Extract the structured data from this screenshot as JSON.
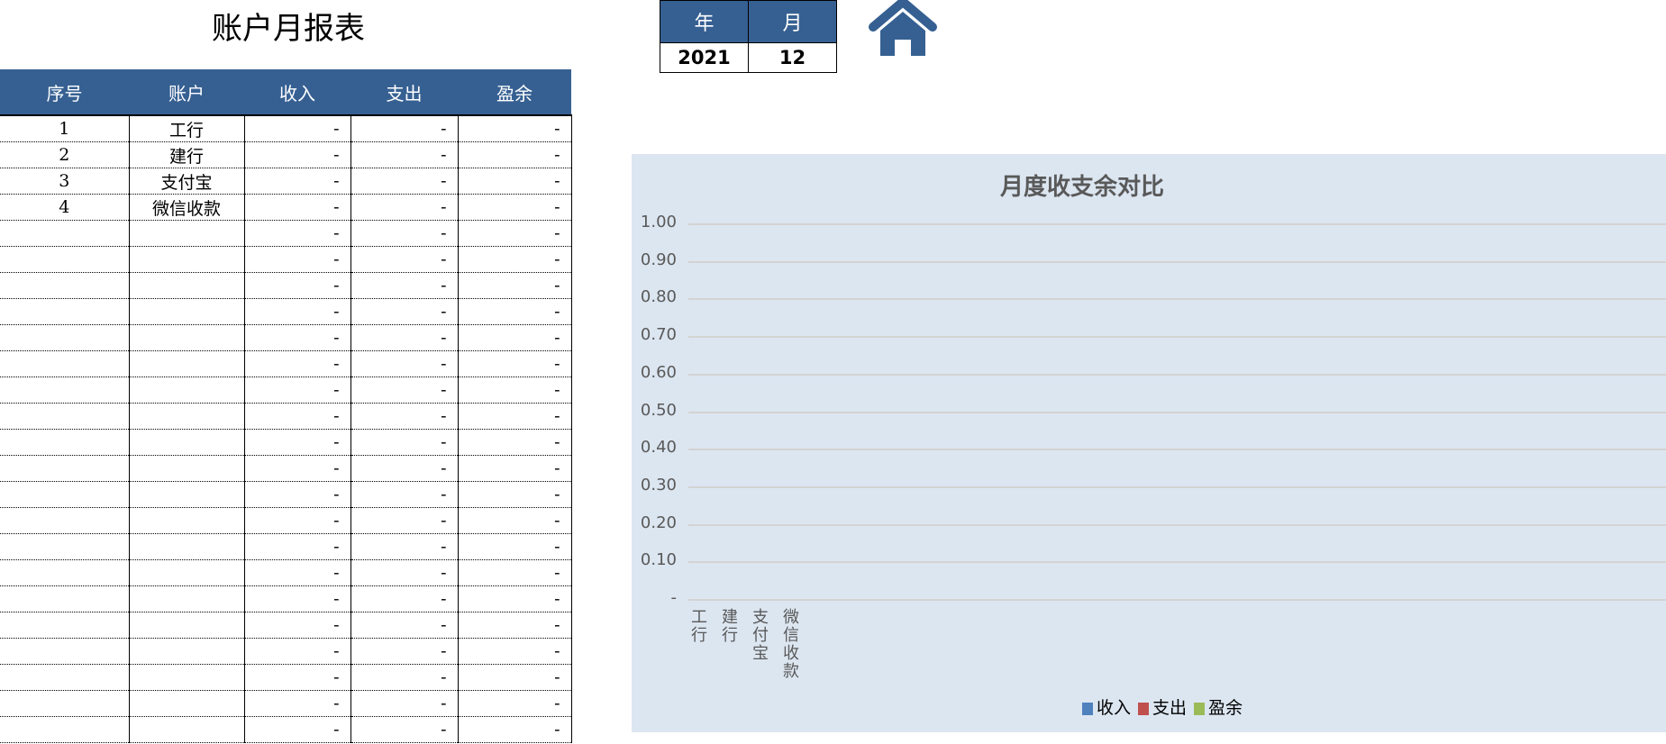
{
  "title": "账户月报表",
  "period": {
    "year_label": "年",
    "month_label": "月",
    "year": "2021",
    "month": "12"
  },
  "table": {
    "headers": [
      "序号",
      "账户",
      "收入",
      "支出",
      "盈余"
    ],
    "rows": [
      [
        "1",
        "工行",
        "-",
        "-",
        "-"
      ],
      [
        "2",
        "建行",
        "-",
        "-",
        "-"
      ],
      [
        "3",
        "支付宝",
        "-",
        "-",
        "-"
      ],
      [
        "4",
        "微信收款",
        "-",
        "-",
        "-"
      ]
    ],
    "empty_value": "-"
  },
  "chart_data": {
    "type": "bar",
    "title": "月度收支余对比",
    "categories": [
      "工行",
      "建行",
      "支付宝",
      "微信收款"
    ],
    "series": [
      {
        "name": "收入",
        "color": "#4f81bd",
        "values": [
          0,
          0,
          0,
          0
        ]
      },
      {
        "name": "支出",
        "color": "#c0504d",
        "values": [
          0,
          0,
          0,
          0
        ]
      },
      {
        "name": "盈余",
        "color": "#9bbb59",
        "values": [
          0,
          0,
          0,
          0
        ]
      }
    ],
    "ylim": [
      0,
      1
    ],
    "yticks": [
      "-",
      "0.10",
      "0.20",
      "0.30",
      "0.40",
      "0.50",
      "0.60",
      "0.70",
      "0.80",
      "0.90",
      "1.00"
    ],
    "grid": true,
    "legend": "bottom"
  }
}
